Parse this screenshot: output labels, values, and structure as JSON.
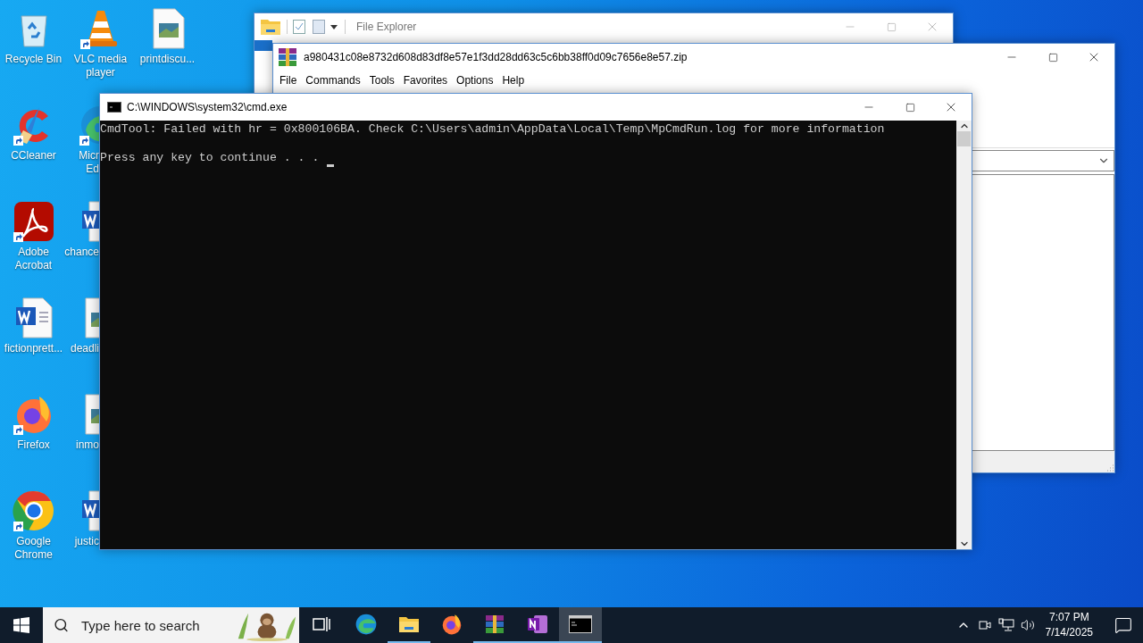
{
  "desktop": {
    "icons": [
      {
        "kind": "recycle",
        "label": [
          "Recycle Bin"
        ],
        "shortcut": false,
        "covered": false
      },
      {
        "kind": "ccleaner",
        "label": [
          "CCleaner"
        ],
        "shortcut": true,
        "covered": false
      },
      {
        "kind": "acrobat",
        "label": [
          "Adobe",
          "Acrobat"
        ],
        "shortcut": true,
        "covered": false
      },
      {
        "kind": "word",
        "label": [
          "fictionprett..."
        ],
        "shortcut": false,
        "covered": false
      },
      {
        "kind": "firefox",
        "label": [
          "Firefox"
        ],
        "shortcut": true,
        "covered": false
      },
      {
        "kind": "chrome",
        "label": [
          "Google",
          "Chrome"
        ],
        "shortcut": true,
        "covered": false
      },
      {
        "kind": "vlc",
        "label": [
          "VLC media",
          "player"
        ],
        "shortcut": true,
        "covered": false
      },
      {
        "kind": "edge",
        "label": [
          "Micr",
          "Ed"
        ],
        "shortcut": true,
        "covered": true
      },
      {
        "kind": "word",
        "label": [
          "chance"
        ],
        "shortcut": false,
        "covered": true
      },
      {
        "kind": "image",
        "label": [
          "deadli"
        ],
        "shortcut": false,
        "covered": true
      },
      {
        "kind": "image",
        "label": [
          "inmo"
        ],
        "shortcut": false,
        "covered": true
      },
      {
        "kind": "word",
        "label": [
          "justic"
        ],
        "shortcut": false,
        "covered": true
      },
      {
        "kind": "image",
        "label": [
          "printdiscu..."
        ],
        "shortcut": false,
        "covered": false
      }
    ]
  },
  "explorer_window": {
    "title": "File Explorer",
    "active": false
  },
  "winrar_window": {
    "title": "a980431c08e8732d608d83df8e57e1f3dd28dd63c5c6bb38ff0d09c7656e8e57.zip",
    "active": false,
    "menu": [
      "File",
      "Commands",
      "Tools",
      "Favorites",
      "Options",
      "Help"
    ]
  },
  "cmd_window": {
    "title": "C:\\WINDOWS\\system32\\cmd.exe",
    "active": true,
    "lines": [
      {
        "text": "CmdTool: Failed with hr = 0x800106BA. Check C:\\Users\\admin\\AppData\\Local\\Temp\\MpCmdRun.log for more information"
      },
      {
        "text": "Press any key to continue . . ."
      }
    ],
    "cursor": true
  },
  "taskbar": {
    "search": {
      "placeholder": "Type here to search"
    },
    "apps": [
      {
        "kind": "taskview",
        "running": false,
        "selected": false
      },
      {
        "kind": "edge",
        "running": false,
        "selected": false
      },
      {
        "kind": "explorer",
        "running": true,
        "selected": false
      },
      {
        "kind": "firefox",
        "running": false,
        "selected": false
      },
      {
        "kind": "winrar",
        "running": true,
        "selected": false
      },
      {
        "kind": "onenote",
        "running": true,
        "selected": false
      },
      {
        "kind": "cmd",
        "running": true,
        "selected": true
      }
    ],
    "time": "7:07 PM",
    "date": "7/14/2025"
  }
}
